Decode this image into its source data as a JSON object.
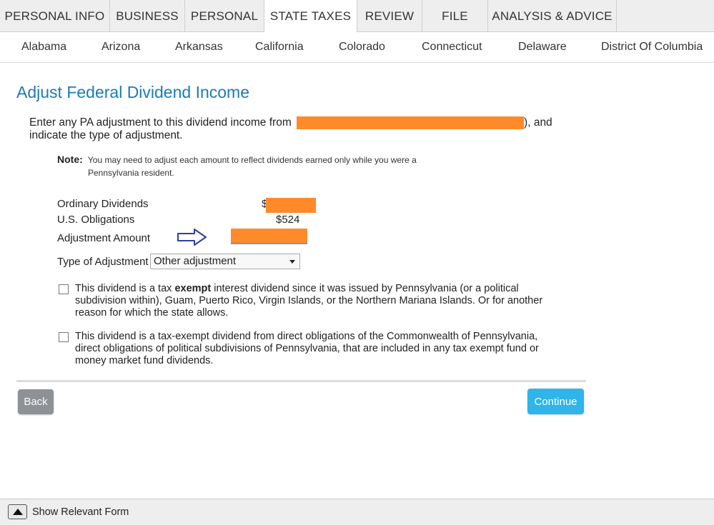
{
  "top_tabs": [
    {
      "label": "PERSONAL INFO"
    },
    {
      "label": "BUSINESS"
    },
    {
      "label": "PERSONAL"
    },
    {
      "label": "STATE TAXES",
      "active": true
    },
    {
      "label": "REVIEW"
    },
    {
      "label": "FILE"
    },
    {
      "label": "ANALYSIS & ADVICE"
    }
  ],
  "states": [
    "Alabama",
    "Arizona",
    "Arkansas",
    "California",
    "Colorado",
    "Connecticut",
    "Delaware",
    "District Of Columbia"
  ],
  "main": {
    "title": "Adjust Federal Dividend Income",
    "intro_before": "Enter any PA adjustment to this dividend income from",
    "intro_after": "), and",
    "intro_line2": "indicate the type of adjustment.",
    "note_label": "Note:",
    "note_text": "You may need to adjust each amount to reflect dividends earned only while you were a Pennsylvania resident."
  },
  "fields": {
    "ordinary_label": "Ordinary Dividends",
    "ordinary_prefix": "$",
    "us_obligations_label": "U.S. Obligations",
    "us_obligations_value": "$524",
    "adjustment_label": "Adjustment Amount",
    "type_label": "Type of Adjustment",
    "type_value": "Other adjustment"
  },
  "checkboxes": [
    {
      "before": "This dividend is a tax",
      "bold": "exempt",
      "after": "interest dividend since it was issued by Pennsylvania (or a political subdivision within), Guam, Puerto Rico, Virgin Islands, or the Northern Mariana Islands. Or for another reason for which the state allows.",
      "checked": false
    },
    {
      "text": "This dividend is a tax-exempt dividend from direct obligations of the Commonwealth of Pennsylvania, direct obligations of political subdivisions of Pennsylvania, that are included in any tax exempt fund or money market fund dividends.",
      "checked": false
    }
  ],
  "buttons": {
    "back": "Back",
    "continue": "Continue"
  },
  "bottom_bar": {
    "label": "Show Relevant Form"
  },
  "colors": {
    "title": "#1a7cb5",
    "redaction": "#ff8a2a",
    "continue_button": "#2fb5ea",
    "back_button": "#8e9195",
    "arrow": "#2f3f9e"
  },
  "icons": {
    "arrow": "right-arrow-outline-icon",
    "dropdown": "caret-down-icon",
    "toggle": "triangle-up-icon"
  }
}
